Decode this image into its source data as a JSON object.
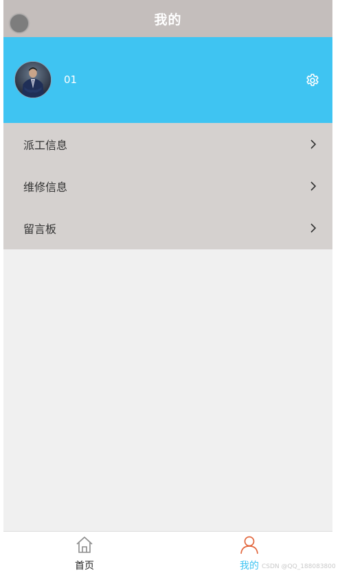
{
  "header": {
    "title": "我的"
  },
  "profile": {
    "username": "01",
    "avatar_icon": "person-photo-avatar",
    "settings_icon": "gear-icon"
  },
  "menu": {
    "items": [
      {
        "label": "派工信息",
        "icon": "chevron-right-icon"
      },
      {
        "label": "维修信息",
        "icon": "chevron-right-icon"
      },
      {
        "label": "留言板",
        "icon": "chevron-right-icon"
      }
    ]
  },
  "tabbar": {
    "tabs": [
      {
        "label": "首页",
        "icon": "home-icon",
        "active": false
      },
      {
        "label": "我的",
        "icon": "person-icon",
        "active": true
      }
    ]
  },
  "watermark": {
    "text": "CSDN @QQ_188083800"
  },
  "colors": {
    "header_bg": "#c4bebc",
    "profile_bg": "#3fc4f2",
    "menu_bg": "#d5d1cf",
    "content_bg": "#f0f0f0",
    "active_tab": "#3fc4f2",
    "active_icon": "#e2673e"
  }
}
